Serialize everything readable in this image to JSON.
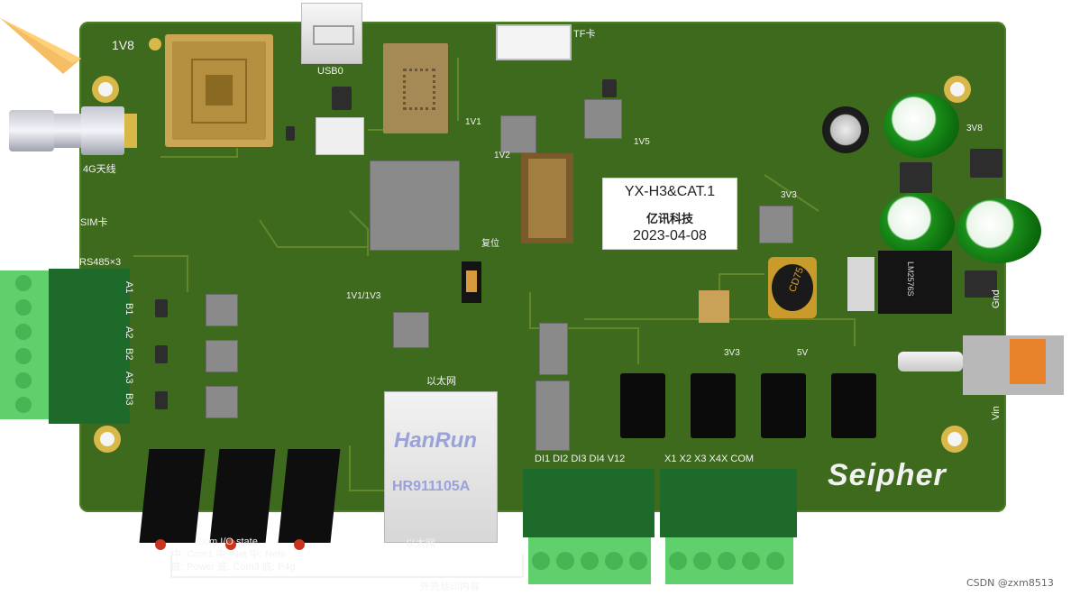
{
  "board": {
    "model": "YX-H3&CAT.1",
    "company": "亿讯科技",
    "date": "2023-04-08",
    "brand_logo": "Seipher"
  },
  "labels": {
    "v1v8": "1V8",
    "usb": "USB0",
    "tf": "TF卡",
    "antenna": "4G天线",
    "sim": "SIM卡",
    "rs485": "RS485×3",
    "v1v1": "1V1",
    "v1v2": "1V2",
    "v1v5": "1V5",
    "v3v8": "3V8",
    "v3v3_top": "3V3",
    "v3v3_bottom": "3V3",
    "v5v": "5V",
    "reset": "复位",
    "v1v1_1v3": "1V1/1V3",
    "ethernet": "以太网",
    "gnd": "Gnd",
    "vin": "Vin",
    "a1": "A1",
    "b1": "B1",
    "a2": "A2",
    "b2": "B2",
    "a3": "A3",
    "b3": "B3",
    "di_header": "DI1 DI2 DI3 DI4 V12",
    "x_header": "X1 X2 X3 X4X  COM",
    "lm": "LM2576S",
    "cd75": "CD75",
    "hanrun": "HanRun",
    "hanrun_model": "HR911105A",
    "led_row1": "Com  I/O  state",
    "led_row2": "中: Com1 中: Net  中: Nets",
    "led_row3": "底: Power 底: Com3 底: P4g",
    "ethernet_bottom": "以太网",
    "shell_print": "外壳丝印内容"
  },
  "watermark": "CSDN @zxm8513"
}
